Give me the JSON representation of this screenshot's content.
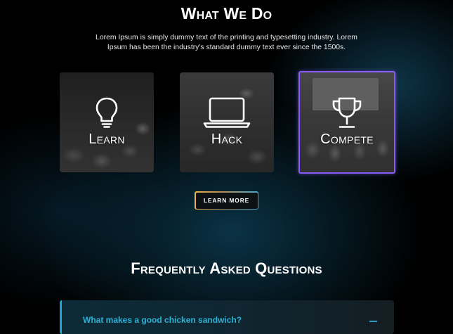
{
  "what_we_do": {
    "title": "What We Do",
    "intro": "Lorem Ipsum is simply dummy text of  the printing and typesetting industry. Lorem Ipsum has been the industry's standard dummy text ever since the 1500s.",
    "cards": [
      {
        "label": "Learn",
        "icon": "lightbulb-icon"
      },
      {
        "label": "Hack",
        "icon": "laptop-icon"
      },
      {
        "label": "Compete",
        "icon": "trophy-icon",
        "selected": true
      }
    ],
    "button_label": "LEARN MORE"
  },
  "faq": {
    "title": "Frequently Asked Questions",
    "items": [
      {
        "question": "What makes a good chicken sandwich?",
        "expanded": true
      }
    ]
  },
  "colors": {
    "background": "#000000",
    "accent_cyan": "#2db3d6",
    "selected_border": "#8a5cf6",
    "button_gradient_start": "#e7b44a",
    "button_gradient_end": "#4aa7c9"
  }
}
